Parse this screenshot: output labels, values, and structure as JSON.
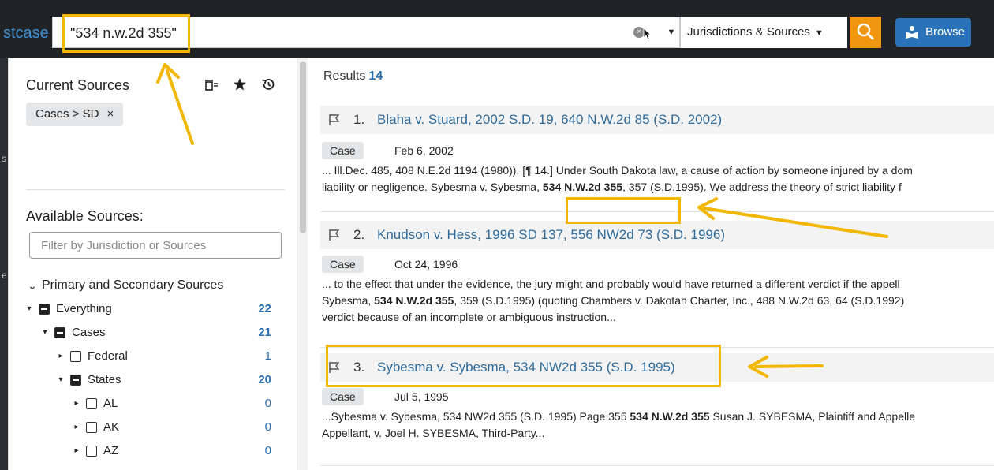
{
  "app": {
    "logo_text": "stcase"
  },
  "search": {
    "query": "\"534 n.w.2d 355\"",
    "jurisdictions_label": "Jurisdictions & Sources",
    "browse_label": "Browse"
  },
  "left_panel": {
    "current_sources_title": "Current Sources",
    "current_source_chip": "Cases > SD",
    "chip_remove": "×",
    "available_sources_title": "Available Sources:",
    "filter_placeholder": "Filter by Jurisdiction or Sources",
    "tree": [
      {
        "label": "Primary and Secondary Sources",
        "count": "",
        "level": 0,
        "arrow": "⌄",
        "checkbox": "none"
      },
      {
        "label": "Everything",
        "count": "22",
        "level": 1,
        "arrow": "▾",
        "checkbox": "checked"
      },
      {
        "label": "Cases",
        "count": "21",
        "level": 2,
        "arrow": "▾",
        "checkbox": "checked"
      },
      {
        "label": "Federal",
        "count": "1",
        "level": 3,
        "arrow": "▸",
        "checkbox": "empty"
      },
      {
        "label": "States",
        "count": "20",
        "level": 3,
        "arrow": "▾",
        "checkbox": "checked"
      },
      {
        "label": "AL",
        "count": "0",
        "level": 4,
        "arrow": "▸",
        "checkbox": "empty"
      },
      {
        "label": "AK",
        "count": "0",
        "level": 4,
        "arrow": "▸",
        "checkbox": "empty"
      },
      {
        "label": "AZ",
        "count": "0",
        "level": 4,
        "arrow": "▸",
        "checkbox": "empty"
      }
    ]
  },
  "results": {
    "label": "Results",
    "count": "14",
    "items": [
      {
        "number": "1.",
        "title": "Blaha v. Stuard, 2002 S.D. 19, 640 N.W.2d 85 (S.D. 2002)",
        "type": "Case",
        "date": "Feb 6, 2002",
        "line1": "... Ill.Dec. 485, 408 N.E.2d 1194 (1980)). [¶ 14.] Under South Dakota law, a cause of action by someone injured by a dom",
        "line2_pre": "liability or negligence. Sybesma v. Sybesma, ",
        "line2_bold": "534 N.W.2d 355",
        "line2_post": ", 357 (S.D.1995). We address the theory of strict liability f"
      },
      {
        "number": "2.",
        "title": "Knudson v. Hess, 1996 SD 137, 556 NW2d 73 (S.D. 1996)",
        "type": "Case",
        "date": "Oct 24, 1996",
        "line1": "... to the effect that under the evidence, the jury might and probably would have returned a different verdict if the appell",
        "line2_pre": "Sybesma, ",
        "line2_bold": "534 N.W.2d 355",
        "line2_post": ", 359 (S.D.1995) (quoting Chambers v. Dakotah Charter, Inc., 488 N.W.2d 63, 64 (S.D.1992)",
        "line3": "verdict because of an incomplete or ambiguous instruction..."
      },
      {
        "number": "3.",
        "title": "Sybesma v. Sybesma, 534 NW2d 355 (S.D. 1995)",
        "type": "Case",
        "date": "Jul 5, 1995",
        "line1_pre": "...Sybesma v. Sybesma, 534 NW2d 355 (S.D. 1995) Page 355 ",
        "line1_bold": "534 N.W.2d 355",
        "line1_post": " Susan J. SYBESMA, Plaintiff and Appelle",
        "line2": "Appellant, v. Joel H. SYBESMA, Third-Party..."
      }
    ]
  },
  "colors": {
    "accent_orange": "#f0960f",
    "annotation_yellow": "#f2b705",
    "link_blue": "#2f6b9a",
    "count_blue": "#2a6fb0",
    "browse_blue": "#2b73b8"
  },
  "icons": [
    "clear-icon",
    "cursor-icon",
    "search-icon",
    "browse-book-icon",
    "filter-icon",
    "star-icon",
    "history-icon",
    "flag-icon",
    "chevron-down-icon"
  ]
}
